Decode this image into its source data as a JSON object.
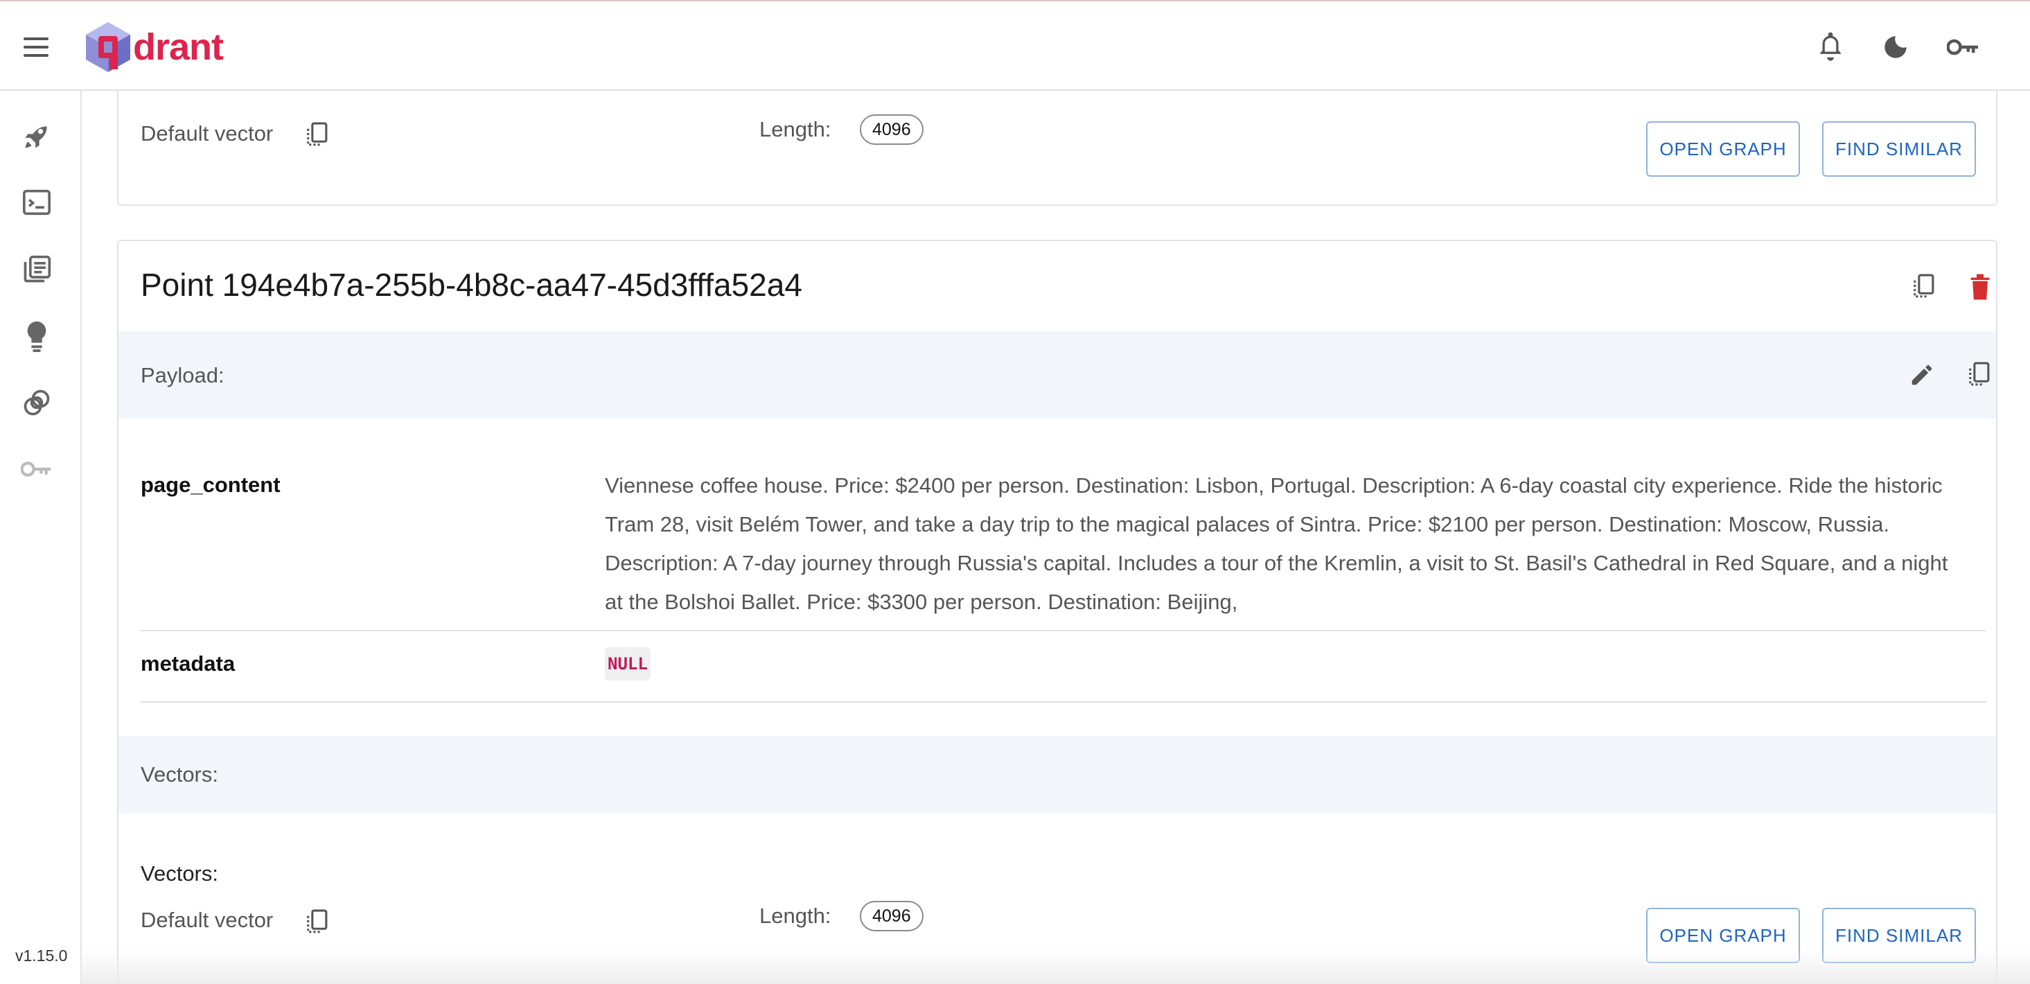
{
  "app": {
    "brand_text": "drant",
    "version": "v1.15.0",
    "brand_color": "#dc244c",
    "accent_color": "#1e64c0"
  },
  "topbar_icons": [
    "menu-icon",
    "bell-icon",
    "moon-icon",
    "key-icon"
  ],
  "sidebar_icons": [
    "rocket-icon",
    "console-icon",
    "collections-icon",
    "lightbulb-icon",
    "datasets-icon",
    "key-icon"
  ],
  "prev_card": {
    "vector_name": "Default vector",
    "length_label": "Length:",
    "length_value": "4096",
    "open_graph": "OPEN GRAPH",
    "find_similar": "FIND SIMILAR"
  },
  "point": {
    "title": "Point 194e4b7a-255b-4b8c-aa47-45d3fffa52a4",
    "payload_label": "Payload:",
    "payload": [
      {
        "key": "page_content",
        "value": "Viennese coffee house. Price: $2400 per person. Destination: Lisbon, Portugal. Description: A 6-day coastal city experience. Ride the historic Tram 28, visit Belém Tower, and take a day trip to the magical palaces of Sintra. Price: $2100 per person. Destination: Moscow, Russia. Description: A 7-day journey through Russia's capital. Includes a tour of the Kremlin, a visit to St. Basil's Cathedral in Red Square, and a night at the Bolshoi Ballet. Price: $3300 per person. Destination: Beijing,"
      },
      {
        "key": "metadata",
        "value": "NULL"
      }
    ],
    "vectors_band_label": "Vectors:",
    "vectors_heading": "Vectors:",
    "vector_name": "Default vector",
    "length_label": "Length:",
    "length_value": "4096",
    "open_graph": "OPEN GRAPH",
    "find_similar": "FIND SIMILAR"
  }
}
